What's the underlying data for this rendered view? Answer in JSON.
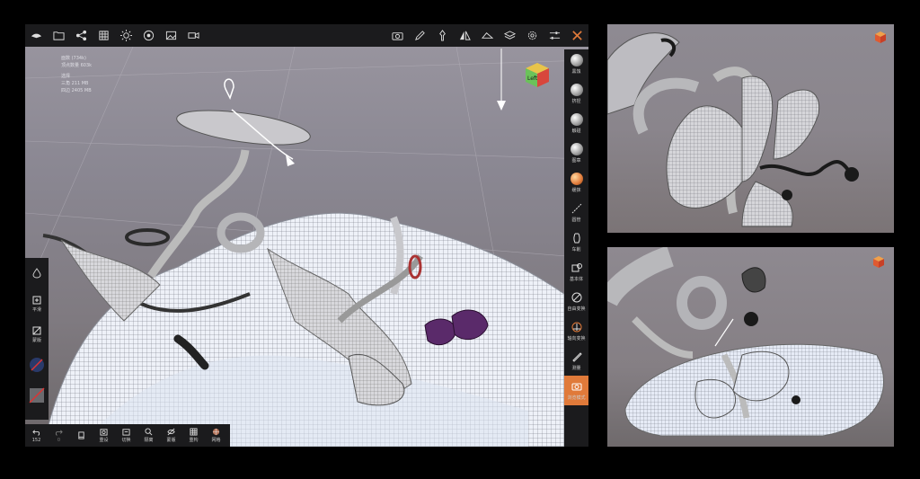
{
  "main_viewport": {
    "stats": [
      "面数 (734k)",
      "顶点数量 603k",
      "",
      "选择",
      "三角   211 MB",
      "四边   2405 MB"
    ],
    "viewcube_label": "Left",
    "top_toolbar": {
      "left_icons": [
        "logo-icon",
        "folder-icon",
        "share-icon",
        "grid-icon",
        "sun-icon",
        "materials-icon",
        "image-icon",
        "video-icon"
      ],
      "right_icons": [
        "camera-icon",
        "pen-icon",
        "pin-icon",
        "symmetry-icon",
        "eraser-icon",
        "layers-icon",
        "settings-icon",
        "sliders-icon",
        "tools-icon"
      ]
    },
    "right_tools": [
      {
        "label": "黑蚀",
        "icon": "sphere-icon"
      },
      {
        "label": "挤捏",
        "icon": "sphere-icon"
      },
      {
        "label": "触碰",
        "icon": "sphere-icon"
      },
      {
        "label": "图章",
        "icon": "sphere-icon"
      },
      {
        "label": "缓抹",
        "icon": "sphere-icon",
        "active": true
      },
      {
        "label": "圆管",
        "icon": "tube-icon"
      },
      {
        "label": "车削",
        "icon": "lathe-icon"
      },
      {
        "label": "基本体",
        "icon": "primitive-icon"
      },
      {
        "label": "自由变换",
        "icon": "transform-icon"
      },
      {
        "label": "轴向变换",
        "icon": "axis-icon"
      },
      {
        "label": "测量",
        "icon": "ruler-icon"
      },
      {
        "label": "浏览模式",
        "icon": "camera-icon",
        "active": true
      }
    ],
    "left_tools": [
      {
        "label": "",
        "icon": "drop-icon"
      },
      {
        "label": "平滑",
        "icon": "smooth-icon"
      },
      {
        "label": "蒙版",
        "icon": "mask-icon"
      },
      {
        "label": "",
        "icon": "disabled-icon"
      },
      {
        "label": "",
        "icon": "color-swatch-icon"
      }
    ],
    "bottom_tools": [
      {
        "label": "152",
        "icon": "undo-icon"
      },
      {
        "label": "0",
        "icon": "redo-icon"
      },
      {
        "label": "",
        "icon": "phone-icon"
      },
      {
        "label": "重设",
        "icon": "reset-icon"
      },
      {
        "label": "切换",
        "icon": "switch-icon"
      },
      {
        "label": "隔离",
        "icon": "isolate-icon"
      },
      {
        "label": "蒙版",
        "icon": "eye-off-icon"
      },
      {
        "label": "重构",
        "icon": "grid-icon"
      },
      {
        "label": "网格",
        "icon": "mesh-icon"
      }
    ]
  },
  "colors": {
    "toolbar_bg": "#1b1b1d",
    "accent": "#e07a3a",
    "mesh_white": "#e8ecf6",
    "purple_flower": "#5a2a6a"
  }
}
